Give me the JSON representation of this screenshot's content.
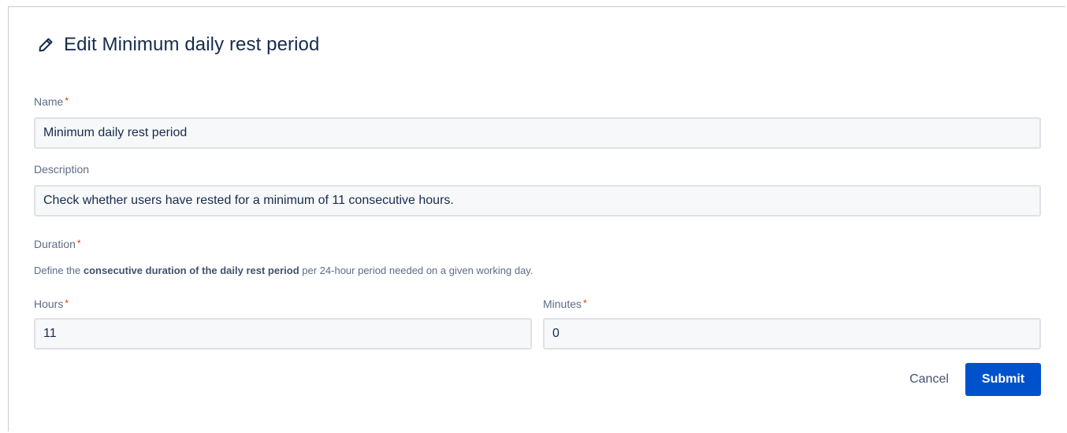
{
  "dialog": {
    "title": "Edit Minimum daily rest period",
    "title_icon": "pencil-icon"
  },
  "form": {
    "name": {
      "label": "Name",
      "required_mark": "*",
      "value": "Minimum daily rest period"
    },
    "description": {
      "label": "Description",
      "value": "Check whether users have rested for a minimum of 11 consecutive hours."
    },
    "duration": {
      "label": "Duration",
      "required_mark": "*",
      "help_prefix": "Define the ",
      "help_bold": "consecutive duration of the daily rest period",
      "help_suffix": " per 24-hour period needed on a given working day."
    },
    "hours": {
      "label": "Hours",
      "required_mark": "*",
      "value": "11"
    },
    "minutes": {
      "label": "Minutes",
      "required_mark": "*",
      "value": "0"
    }
  },
  "actions": {
    "cancel_label": "Cancel",
    "submit_label": "Submit"
  },
  "colors": {
    "accent": "#0052cc",
    "required": "#de350b",
    "field_bg": "#f7f8f9",
    "field_border": "#dfe1e6"
  }
}
